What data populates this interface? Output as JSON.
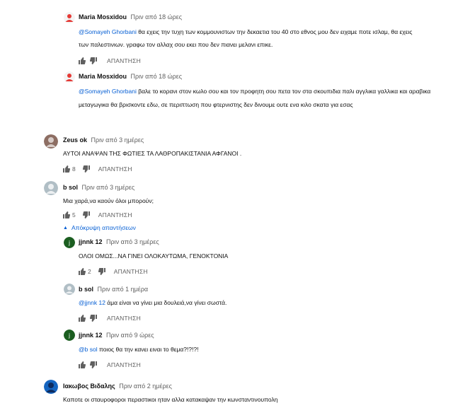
{
  "comments": [
    {
      "author": "Maria Mosxidou",
      "time": "Πριν από 18 ώρες",
      "mention": "@Somayeh Ghorbani",
      "line1": " θα εχεις την τυχη των κομμουνιστων την δεκαετια του 40 στο εθνος μου δεν ειχαμε ποτε ισλαμ, θα εχεις",
      "line2": "των παλεστινιων. γραφω τον αλλαχ  σου εκει που δεν πιανει μελανι επικε.",
      "likes": "",
      "reply": "ΑΠΑΝΤΗΣΗ",
      "avatar_color": "#e53935"
    },
    {
      "author": "Maria Mosxidou",
      "time": "Πριν από 18 ώρες",
      "mention": "@Somayeh Ghorbani",
      "line1": " βαλε το κορανι στον κωλο σου και τον προφητη σου πετα τον στα σκουπιδια παλι αγγλικα γαλλικα και αραβικα",
      "line2": "μεταγωγικα θα βρισκοντε εδω, σε περιπτωση που φτερνιστης δεν δινουμε ουτε ενα κιλο σκατα για εσας",
      "likes": "",
      "reply": "ΑΠΑΝΤΗΣΗ",
      "avatar_color": "#e53935"
    },
    {
      "author": "Zeus ok",
      "time": "Πριν από 3 ημέρες",
      "line1": "ΑΥΤΟΙ ΑΝΑΨΑΝ ΤΗΣ ΦΩΤΙΕΣ ΤΑ ΛΑΘΡΟΠΑΚΙΣΤΑΝΙΑ ΑΦΓΑΝΟΙ .",
      "likes": "8",
      "reply": "ΑΠΑΝΤΗΣΗ",
      "avatar_color": "#8d6e63"
    },
    {
      "author": "b sol",
      "time": "Πριν από 3 ημέρες",
      "line1": "Μια χαρά,να καούν όλοι μπορούν;",
      "likes": "5",
      "reply": "ΑΠΑΝΤΗΣΗ",
      "avatar_color": "#90a4ae"
    },
    {
      "author": "jjnnk 12",
      "time": "Πριν από 3 ημέρες",
      "line1": "ΟΛΟΙ ΟΜΩΣ...ΝΑ ΓΙΝΕΙ ΟΛΟΚΑΥΤΩΜΑ, ΓΕΝΟΚΤΟΝΙΑ",
      "likes": "2",
      "reply": "ΑΠΑΝΤΗΣΗ",
      "avatar_color": "#1b5e20",
      "avatar_letter": "j"
    },
    {
      "author": "b sol",
      "time": "Πριν από 1 ημέρα",
      "mention": "@jjnnk 12",
      "line1": " άμα είναι να γίνει μια δουλειά,να γίνει σωστά.",
      "likes": "",
      "reply": "ΑΠΑΝΤΗΣΗ",
      "avatar_color": "#90a4ae"
    },
    {
      "author": "jjnnk 12",
      "time": "Πριν από 9 ώρες",
      "mention": "@b sol",
      "line1": " ποιος θα την κανει ειναι το θεμα?!?!?!",
      "likes": "",
      "reply": "ΑΠΑΝΤΗΣΗ",
      "avatar_color": "#1b5e20",
      "avatar_letter": "j"
    },
    {
      "author": "Ιακωβος Βιδαλης",
      "time": "Πριν από 2 ημέρες",
      "line1": "Καποτε οι σταυροφοροι περαστικοι ηταν αλλα κατακαψαν την κωνσταντινουπολη",
      "avatar_color": "#1565c0"
    }
  ],
  "hide_replies": "Απόκρυψη απαντήσεων",
  "colors": {
    "link": "#065fd4",
    "secondary": "#606060"
  }
}
